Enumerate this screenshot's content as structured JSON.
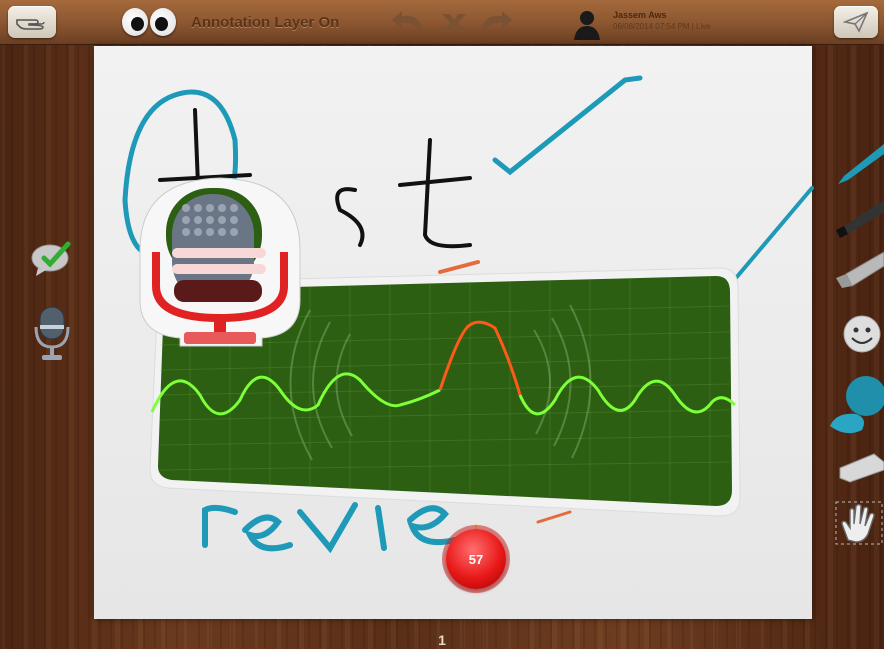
{
  "toolbar": {
    "layer_status": "Annotation Layer On",
    "user_name": "Jassem Aws",
    "user_date": "06/08/2014 07:54 PM | Live"
  },
  "canvas": {
    "handwriting": [
      "test",
      "revie"
    ]
  },
  "recorder": {
    "elapsed_seconds": "57"
  },
  "footer": {
    "page_number": "1"
  },
  "icons": {
    "left_tools": [
      "chat-check-icon",
      "microphone-icon"
    ],
    "right_tools": [
      "pen-icon",
      "marker-icon",
      "highlighter-icon",
      "emoji-icon",
      "fill-icon",
      "eraser-icon",
      "hand-icon"
    ],
    "top_tools": [
      "pointer-hand-icon",
      "eyes-icon",
      "undo-icon",
      "clear-icon",
      "redo-icon",
      "user-avatar-icon",
      "send-icon"
    ]
  },
  "colors": {
    "wave_green": "#7dff3a",
    "wave_peak": "#ff5a1a",
    "panel_green": "#2c5f12",
    "pen_blue": "#1e9ab8",
    "record_red": "#e81818"
  }
}
